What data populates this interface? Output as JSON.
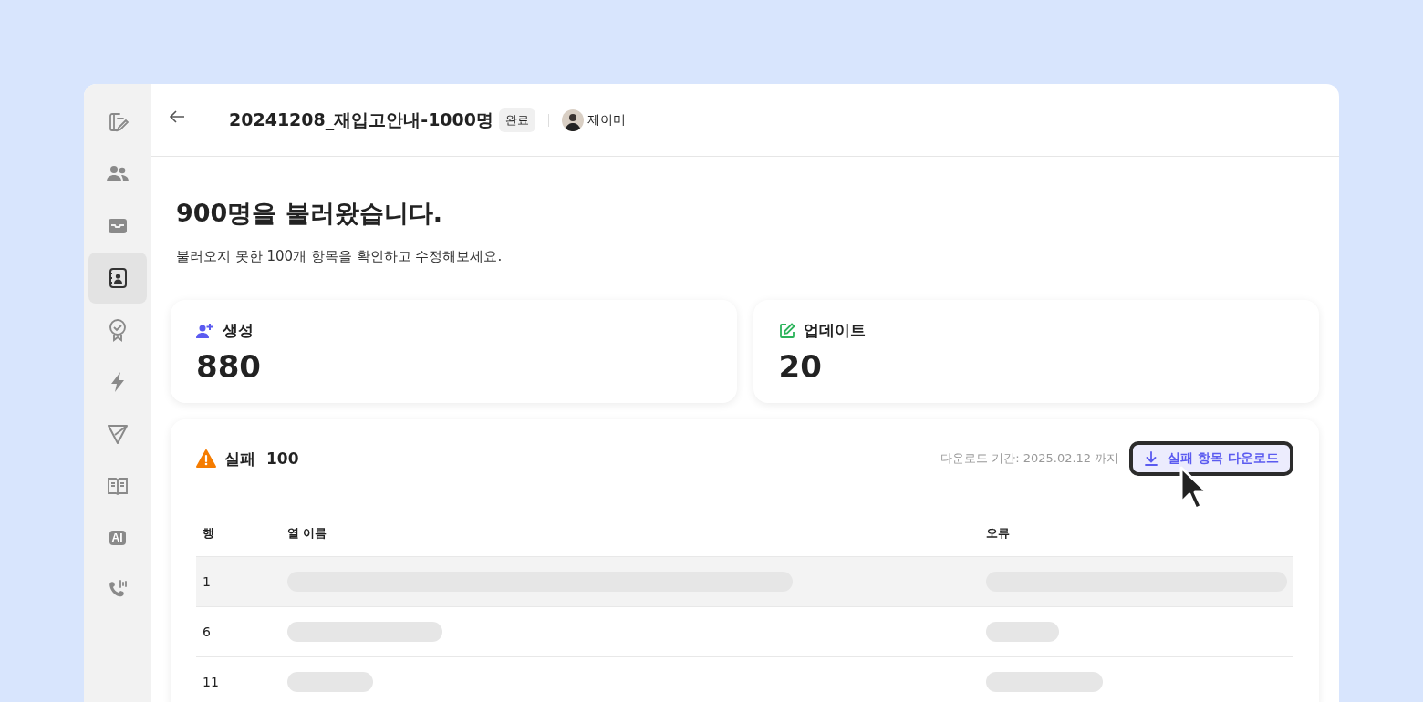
{
  "sidebar": {
    "items": [
      {
        "kind": "note",
        "selected": false
      },
      {
        "kind": "people",
        "selected": false
      },
      {
        "kind": "inbox",
        "selected": false
      },
      {
        "kind": "contact",
        "selected": true
      },
      {
        "kind": "badge",
        "selected": false
      },
      {
        "kind": "bolt",
        "selected": false
      },
      {
        "kind": "send",
        "selected": false
      },
      {
        "kind": "book",
        "selected": false
      },
      {
        "kind": "ai",
        "label": "AI",
        "selected": false
      },
      {
        "kind": "phone",
        "selected": false
      }
    ]
  },
  "header": {
    "title": "20241208_재입고안내-1000명",
    "status": "완료",
    "user": "제이미"
  },
  "heading": "900명을 불러왔습니다.",
  "subheading": "불러오지 못한 100개 항목을 확인하고 수정해보세요.",
  "stats": [
    {
      "kind": "created",
      "label": "생성",
      "value": "880"
    },
    {
      "kind": "updated",
      "label": "업데이트",
      "value": "20"
    }
  ],
  "failures": {
    "label": "실패",
    "count": "100",
    "deadline": "다운로드 기간: 2025.02.12 까지",
    "button": "실패 항목 다운로드",
    "columns": [
      "행",
      "열 이름",
      "오류"
    ],
    "rows": [
      {
        "row": "1",
        "selected": true
      },
      {
        "row": "6",
        "selected": false
      },
      {
        "row": "11",
        "selected": false
      }
    ]
  }
}
